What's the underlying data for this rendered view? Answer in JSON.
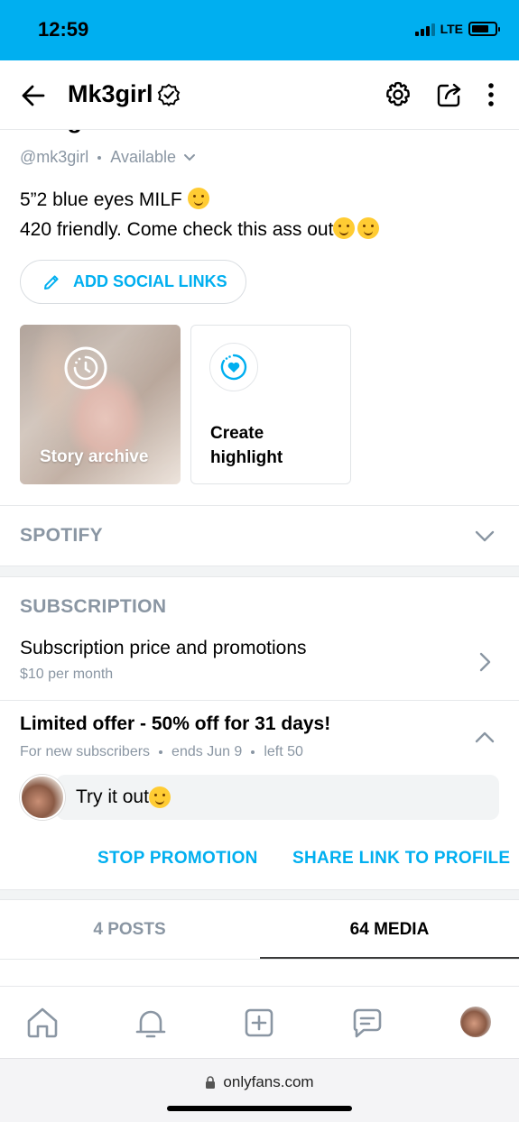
{
  "status": {
    "time": "12:59",
    "network": "LTE"
  },
  "header": {
    "title": "Mk3girl"
  },
  "profile": {
    "name": "Mk3girl",
    "handle": "@mk3girl",
    "availability": "Available",
    "bio_line1": "5”2 blue eyes MILF",
    "bio_line2": "420 friendly. Come check this ass out"
  },
  "social": {
    "button_label": "ADD SOCIAL LINKS"
  },
  "highlights": {
    "story_archive_label": "Story archive",
    "create_line1": "Create",
    "create_line2": "highlight"
  },
  "spotify": {
    "title": "SPOTIFY"
  },
  "subscription": {
    "title": "SUBSCRIPTION",
    "price_title": "Subscription price and promotions",
    "price_sub": "$10 per month"
  },
  "promotion": {
    "title": "Limited offer - 50% off for 31 days!",
    "meta_1": "For new subscribers",
    "meta_2": "ends Jun 9",
    "meta_3": "left 50",
    "message": "Try it out",
    "stop_label": "STOP PROMOTION",
    "share_label": "SHARE LINK TO PROFILE"
  },
  "tabs": [
    {
      "label": "4 POSTS",
      "active": false
    },
    {
      "label": "64 MEDIA",
      "active": true
    }
  ],
  "browser": {
    "url": "onlyfans.com"
  },
  "colors": {
    "accent": "#00aff0",
    "muted": "#8a96a3"
  }
}
